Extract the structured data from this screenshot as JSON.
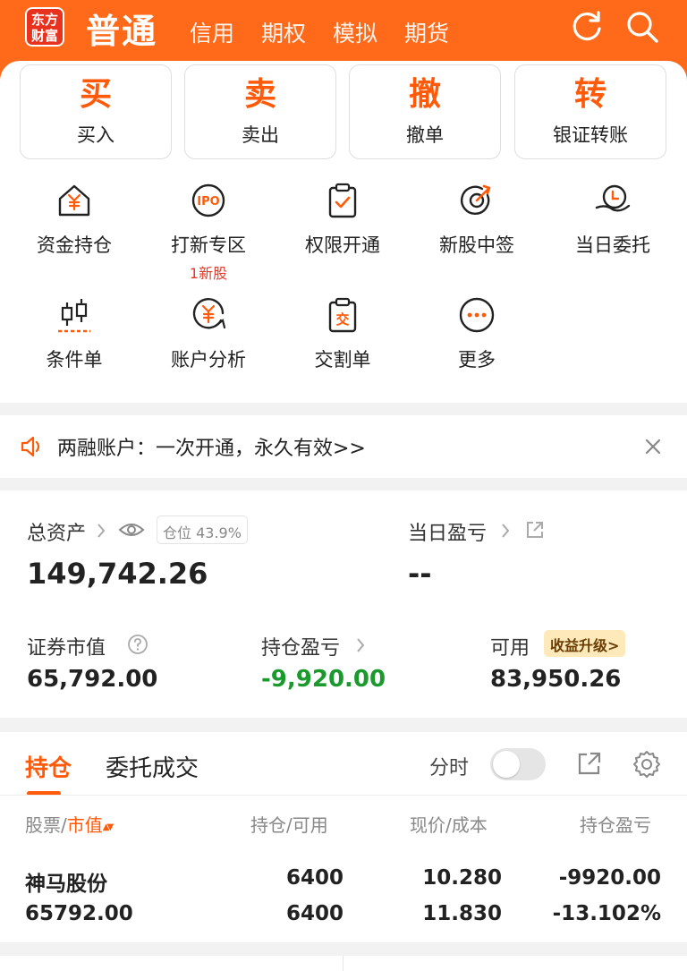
{
  "header": {
    "logo": [
      "东方",
      "财富"
    ],
    "active_tab": "普通",
    "tabs": [
      "信用",
      "期权",
      "模拟",
      "期货"
    ],
    "icons": [
      "refresh-icon",
      "search-icon"
    ]
  },
  "actions": [
    {
      "big": "买",
      "small": "买入"
    },
    {
      "big": "卖",
      "small": "卖出"
    },
    {
      "big": "撤",
      "small": "撤单"
    },
    {
      "big": "转",
      "small": "银证转账"
    }
  ],
  "grid": [
    {
      "label": "资金持仓",
      "icon": "house-yen-icon"
    },
    {
      "label": "打新专区",
      "icon": "ipo-icon",
      "sub": "1新股"
    },
    {
      "label": "权限开通",
      "icon": "clipboard-check-icon"
    },
    {
      "label": "新股中签",
      "icon": "target-icon"
    },
    {
      "label": "当日委托",
      "icon": "hand-clock-icon"
    },
    {
      "label": "条件单",
      "icon": "candlestick-icon"
    },
    {
      "label": "账户分析",
      "icon": "yen-chart-icon"
    },
    {
      "label": "交割单",
      "icon": "delivery-slip-icon"
    },
    {
      "label": "更多",
      "icon": "more-icon"
    }
  ],
  "notice": {
    "text": "两融账户：一次开通，永久有效>>"
  },
  "assets": {
    "total_label": "总资产",
    "position_chip_label": "仓位",
    "position_chip_value": "43.9%",
    "total_value": "149,742.26",
    "daily_pl_label": "当日盈亏",
    "daily_pl_value": "--",
    "market_value_label": "证券市值",
    "market_value": "65,792.00",
    "holding_pl_label": "持仓盈亏",
    "holding_pl": "-9,920.00",
    "available_label": "可用",
    "available_value": "83,950.26",
    "upgrade_badge": "收益升级>"
  },
  "positions": {
    "tab_active": "持仓",
    "tab_other": "委托成交",
    "time_share_label": "分时",
    "col_stock": "股票/",
    "col_stock_sort": "市值",
    "col_sort_icon": "▲▼",
    "col_holding": "持仓/可用",
    "col_price": "现价/成本",
    "col_pl": "持仓盈亏",
    "rows": [
      {
        "name": "神马股份",
        "market_value": "65792.00",
        "holding": "6400",
        "available": "6400",
        "price": "10.280",
        "cost": "11.830",
        "pl": "-9920.00",
        "pl_pct": "-13.102%"
      }
    ]
  },
  "colors": {
    "brand": "#ff6a1a",
    "accent": "#ff5a0a",
    "negative": "#1a9a2c"
  }
}
